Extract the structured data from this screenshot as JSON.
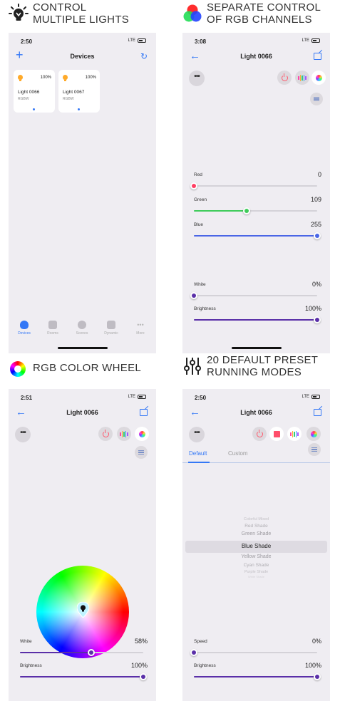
{
  "colors": {
    "accent": "#3478f6",
    "red": "#ff3e63",
    "green": "#3ecb5a",
    "blue": "#4a66e6",
    "purple": "#5a2fa8",
    "power": "#ff5a6e"
  },
  "captions": {
    "tl": [
      "CONTROL",
      "MULTIPLE LIGHTS"
    ],
    "tr": [
      "SEPARATE CONTROL",
      "OF RGB CHANNELS"
    ],
    "bl": [
      "RGB COLOR WHEEL"
    ],
    "br": [
      "20 DEFAULT PRESET",
      "RUNNING MODES"
    ]
  },
  "devices_screen": {
    "time": "2:50",
    "network": "LTE",
    "add_label": "+",
    "refresh_label": "↻",
    "title": "Devices",
    "cards": [
      {
        "name": "Light 0066",
        "type": "RGBW",
        "brightness": "100%"
      },
      {
        "name": "Light 0067",
        "type": "RGBW",
        "brightness": "100%"
      }
    ],
    "tabs": [
      "Devices",
      "Rooms",
      "Scenes",
      "Dynamic",
      "More"
    ]
  },
  "rgb_screen": {
    "time": "3:08",
    "network": "LTE",
    "back_label": "←",
    "title": "Light 0066",
    "more_label": "•••",
    "sliders": [
      {
        "label": "Red",
        "value": "0",
        "fraction": 0.0,
        "color": "#ff3e63"
      },
      {
        "label": "Green",
        "value": "109",
        "fraction": 0.43,
        "color": "#3ecb5a"
      },
      {
        "label": "Blue",
        "value": "255",
        "fraction": 1.0,
        "color": "#4a66e6"
      },
      {
        "label": "White",
        "value": "0%",
        "fraction": 0.0,
        "color": "#5a2fa8"
      },
      {
        "label": "Brightness",
        "value": "100%",
        "fraction": 1.0,
        "color": "#5a2fa8"
      }
    ]
  },
  "wheel_screen": {
    "time": "2:51",
    "network": "LTE",
    "back_label": "←",
    "title": "Light 0066",
    "more_label": "•••",
    "sliders": [
      {
        "label": "White",
        "value": "58%",
        "fraction": 0.58,
        "color": "#5a2fa8"
      },
      {
        "label": "Brightness",
        "value": "100%",
        "fraction": 1.0,
        "color": "#5a2fa8"
      }
    ]
  },
  "modes_screen": {
    "time": "2:50",
    "network": "LTE",
    "back_label": "←",
    "title": "Light 0066",
    "more_label": "•••",
    "tabs": [
      "Default",
      "Custom"
    ],
    "modes": [
      "Colorful Mixed",
      "Red Shade",
      "Green Shade",
      "Blue Shade",
      "Yellow Shade",
      "Cyan Shade",
      "Purple Shade",
      "White Shade"
    ],
    "selected_mode": "Blue Shade",
    "sliders": [
      {
        "label": "Speed",
        "value": "0%",
        "fraction": 0.0,
        "color": "#5a2fa8"
      },
      {
        "label": "Brightness",
        "value": "100%",
        "fraction": 1.0,
        "color": "#5a2fa8"
      }
    ]
  }
}
